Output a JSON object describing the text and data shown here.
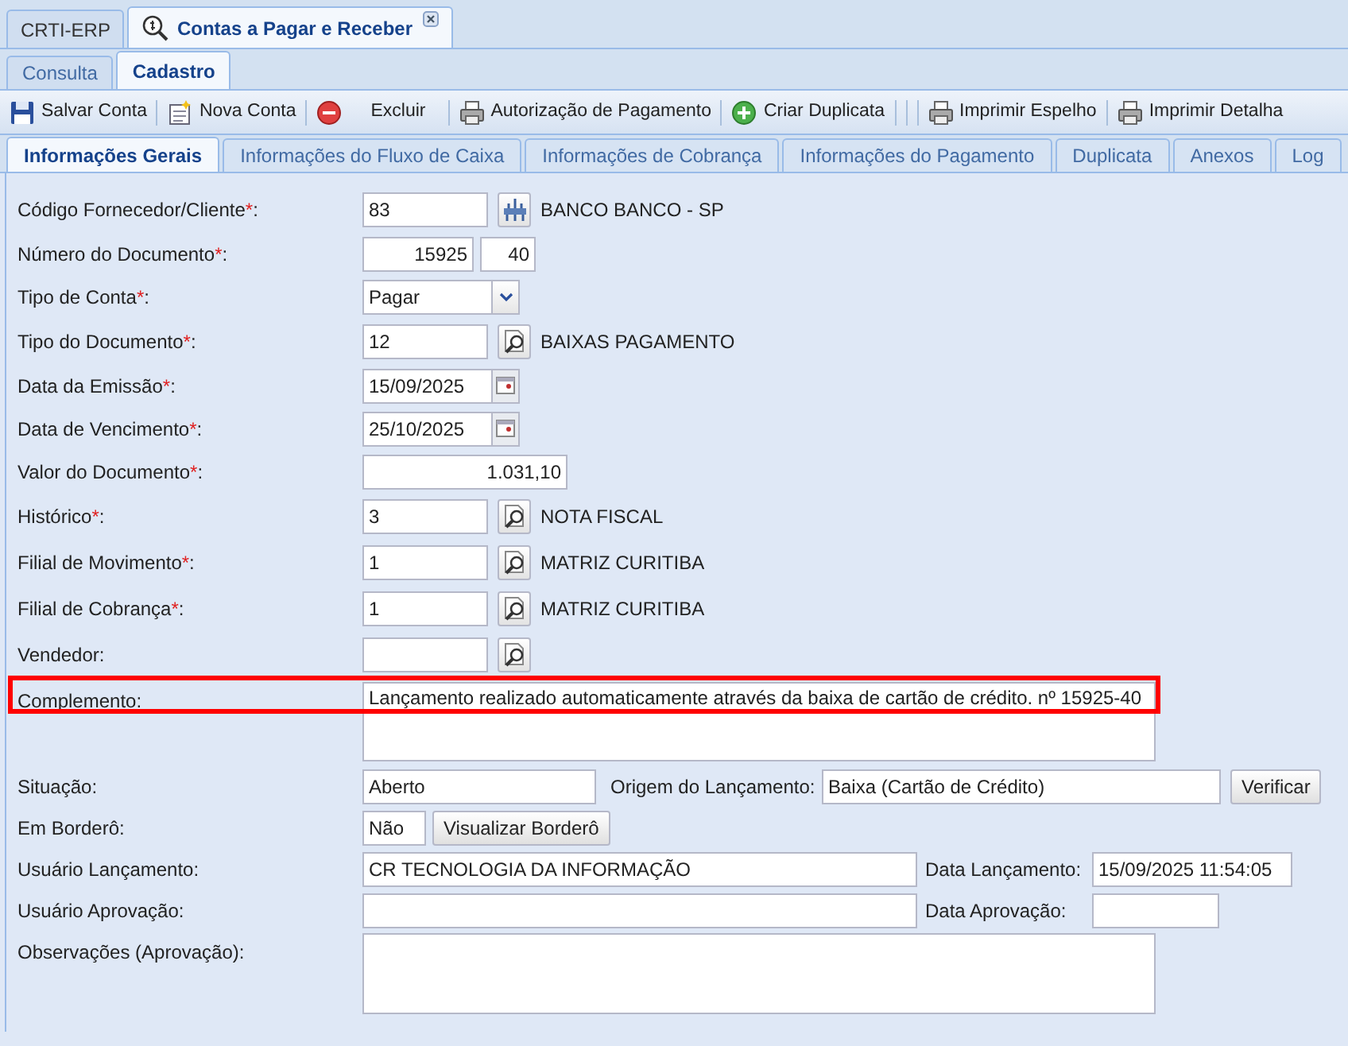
{
  "window_tabs": [
    {
      "label": "CRTI-ERP",
      "selected": false,
      "closable": false
    },
    {
      "label": "Contas a Pagar e Receber",
      "selected": true,
      "closable": true
    }
  ],
  "mode_tabs": [
    {
      "label": "Consulta",
      "selected": false
    },
    {
      "label": "Cadastro",
      "selected": true
    }
  ],
  "toolbar": [
    {
      "kind": "save",
      "label": "Salvar Conta"
    },
    {
      "kind": "new",
      "label": "Nova Conta"
    },
    {
      "kind": "delete",
      "label": "Excluir"
    },
    {
      "kind": "print",
      "label": "Autorização de Pagamento"
    },
    {
      "kind": "add",
      "label": "Criar Duplicata"
    },
    {
      "kind": "print",
      "label": "Imprimir Espelho"
    },
    {
      "kind": "print",
      "label": "Imprimir Detalha"
    }
  ],
  "section_tabs": [
    {
      "label": "Informações Gerais",
      "selected": true
    },
    {
      "label": "Informações do Fluxo de Caixa",
      "selected": false
    },
    {
      "label": "Informações de Cobrança",
      "selected": false
    },
    {
      "label": "Informações do Pagamento",
      "selected": false
    },
    {
      "label": "Duplicata",
      "selected": false
    },
    {
      "label": "Anexos",
      "selected": false
    },
    {
      "label": "Log",
      "selected": false
    }
  ],
  "fields": [
    {
      "kind": "entity_lookup",
      "label": "Código Fornecedor/Cliente",
      "required_mark": "*",
      "suffix": ":",
      "value": "83",
      "description": "BANCO BANCO - SP"
    },
    {
      "kind": "pair",
      "label": "Número do Documento",
      "required_mark": "*",
      "suffix": ":",
      "values": [
        "15925",
        "40"
      ]
    },
    {
      "kind": "select",
      "label": "Tipo de Conta",
      "required_mark": "*",
      "suffix": ":",
      "value": "Pagar"
    },
    {
      "kind": "lookup",
      "label": "Tipo do Documento",
      "required_mark": "*",
      "suffix": ":",
      "value": "12",
      "description": "BAIXAS PAGAMENTO"
    },
    {
      "kind": "date",
      "label": "Data da Emissão",
      "required_mark": "*",
      "suffix": ":",
      "value": "15/09/2025"
    },
    {
      "kind": "date",
      "label": "Data de Vencimento",
      "required_mark": "*",
      "suffix": ":",
      "value": "25/10/2025"
    },
    {
      "kind": "amount",
      "label": "Valor do Documento",
      "required_mark": "*",
      "suffix": ":",
      "value": "1.031,10"
    },
    {
      "kind": "lookup",
      "label": "Histórico",
      "required_mark": "*",
      "suffix": ":",
      "value": "3",
      "description": "NOTA FISCAL"
    },
    {
      "kind": "lookup",
      "label": "Filial de Movimento",
      "required_mark": "*",
      "suffix": ":",
      "value": "1",
      "description": "MATRIZ CURITIBA"
    },
    {
      "kind": "lookup",
      "label": "Filial de Cobrança",
      "required_mark": "*",
      "suffix": ":",
      "value": "1",
      "description": "MATRIZ CURITIBA"
    },
    {
      "kind": "lookup",
      "label": "Vendedor",
      "suffix": ":"
    }
  ],
  "complemento": {
    "label": "Complemento:",
    "value": "Lançamento realizado automaticamente através da baixa de cartão de crédito. nº 15925-40",
    "highlighted": true
  },
  "situacao": {
    "label": "Situação:",
    "value": "Aberto"
  },
  "origem": {
    "label": "Origem do Lançamento:",
    "value": "Baixa (Cartão de Crédito)",
    "button": "Verificar"
  },
  "em_bordero": {
    "label": "Em Borderô:",
    "value": "Não",
    "button": "Visualizar Borderô"
  },
  "usuario_lancamento": {
    "label": "Usuário Lançamento:",
    "value": "CR TECNOLOGIA DA INFORMAÇÃO"
  },
  "data_lancamento": {
    "label": "Data Lançamento:",
    "value": "15/09/2025 11:54:05"
  },
  "usuario_aprovacao": {
    "label": "Usuário Aprovação:"
  },
  "data_aprovacao": {
    "label": "Data Aprovação:"
  },
  "observacoes": {
    "label": "Observações (Aprovação):"
  }
}
